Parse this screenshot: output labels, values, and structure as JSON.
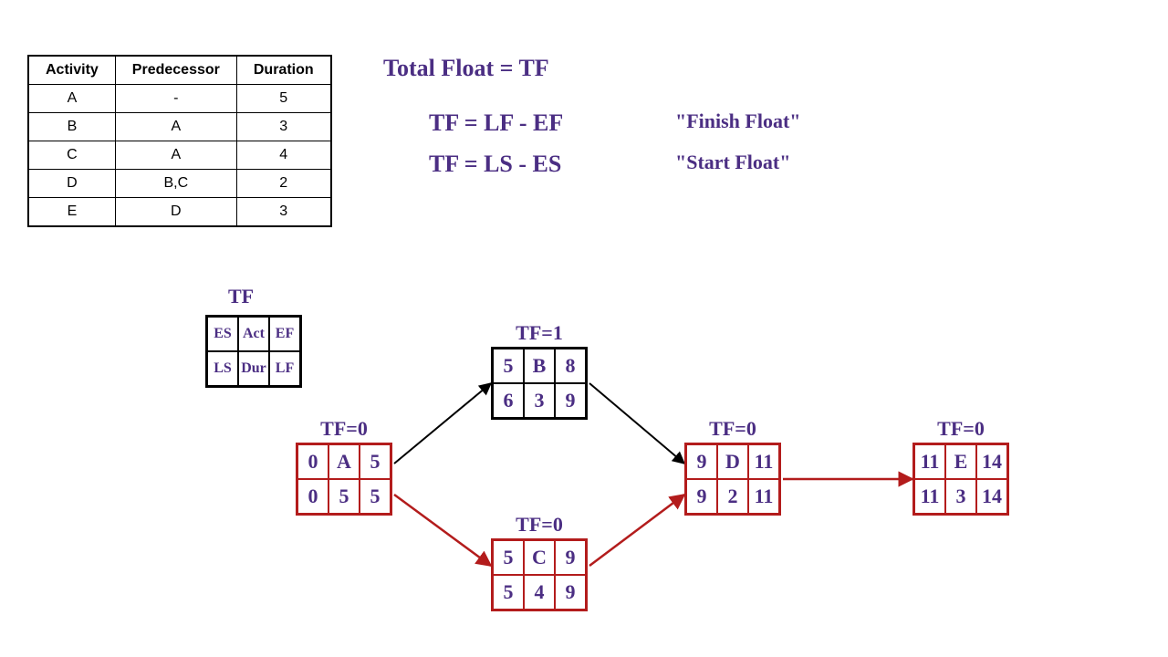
{
  "table": {
    "headers": [
      "Activity",
      "Predecessor",
      "Duration"
    ],
    "rows": [
      {
        "activity": "A",
        "predecessor": "-",
        "duration": "5"
      },
      {
        "activity": "B",
        "predecessor": "A",
        "duration": "3"
      },
      {
        "activity": "C",
        "predecessor": "A",
        "duration": "4"
      },
      {
        "activity": "D",
        "predecessor": "B,C",
        "duration": "2"
      },
      {
        "activity": "E",
        "predecessor": "D",
        "duration": "3"
      }
    ]
  },
  "formulas": {
    "title": "Total Float = TF",
    "eq1": "TF = LF - EF",
    "eq1_note": "\"Finish Float\"",
    "eq2": "TF = LS - ES",
    "eq2_note": "\"Start Float\""
  },
  "legend": {
    "tf": "TF",
    "es": "ES",
    "act": "Act",
    "ef": "EF",
    "ls": "LS",
    "dur": "Dur",
    "lf": "LF"
  },
  "nodes": {
    "A": {
      "tf": "TF=0",
      "es": "0",
      "id": "A",
      "ef": "5",
      "ls": "0",
      "dur": "5",
      "lf": "5",
      "critical": true
    },
    "B": {
      "tf": "TF=1",
      "es": "5",
      "id": "B",
      "ef": "8",
      "ls": "6",
      "dur": "3",
      "lf": "9",
      "critical": false
    },
    "C": {
      "tf": "TF=0",
      "es": "5",
      "id": "C",
      "ef": "9",
      "ls": "5",
      "dur": "4",
      "lf": "9",
      "critical": true
    },
    "D": {
      "tf": "TF=0",
      "es": "9",
      "id": "D",
      "ef": "11",
      "ls": "9",
      "dur": "2",
      "lf": "11",
      "critical": true
    },
    "E": {
      "tf": "TF=0",
      "es": "11",
      "id": "E",
      "ef": "14",
      "ls": "11",
      "dur": "3",
      "lf": "14",
      "critical": true
    }
  }
}
